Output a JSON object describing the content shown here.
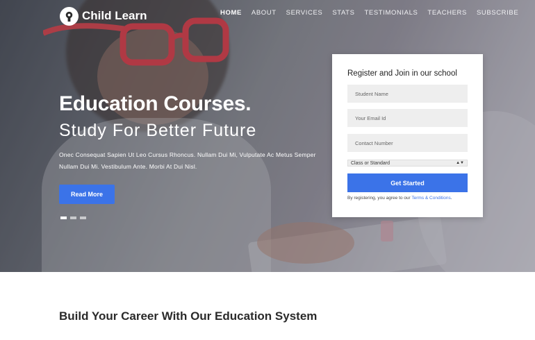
{
  "brand": {
    "name": "Child Learn"
  },
  "nav": {
    "items": [
      {
        "label": "HOME",
        "active": true
      },
      {
        "label": "ABOUT"
      },
      {
        "label": "SERVICES"
      },
      {
        "label": "STATS"
      },
      {
        "label": "TESTIMONIALS"
      },
      {
        "label": "TEACHERS"
      },
      {
        "label": "SUBSCRIBE"
      }
    ]
  },
  "hero": {
    "headline": "Education Courses.",
    "subheadline": "Study For Better Future",
    "description": "Onec Consequat Sapien Ut Leo Cursus Rhoncus. Nullam Dui Mi, Vulputate Ac Metus Semper Nullam Dui Mi. Vestibulum Ante. Morbi At Dui Nisl.",
    "cta_label": "Read More",
    "slides": 3,
    "active_slide": 1
  },
  "form": {
    "title": "Register and Join in our school",
    "name_placeholder": "Student Name",
    "email_placeholder": "Your Email Id",
    "phone_placeholder": "Contact Number",
    "select_value": "Class or Standard",
    "submit_label": "Get Started",
    "terms_prefix": "By registering, you agree to our ",
    "terms_link": "Terms & Conditions",
    "terms_suffix": "."
  },
  "section": {
    "title": "Build Your Career With Our Education System"
  },
  "colors": {
    "accent": "#3b73e8"
  }
}
